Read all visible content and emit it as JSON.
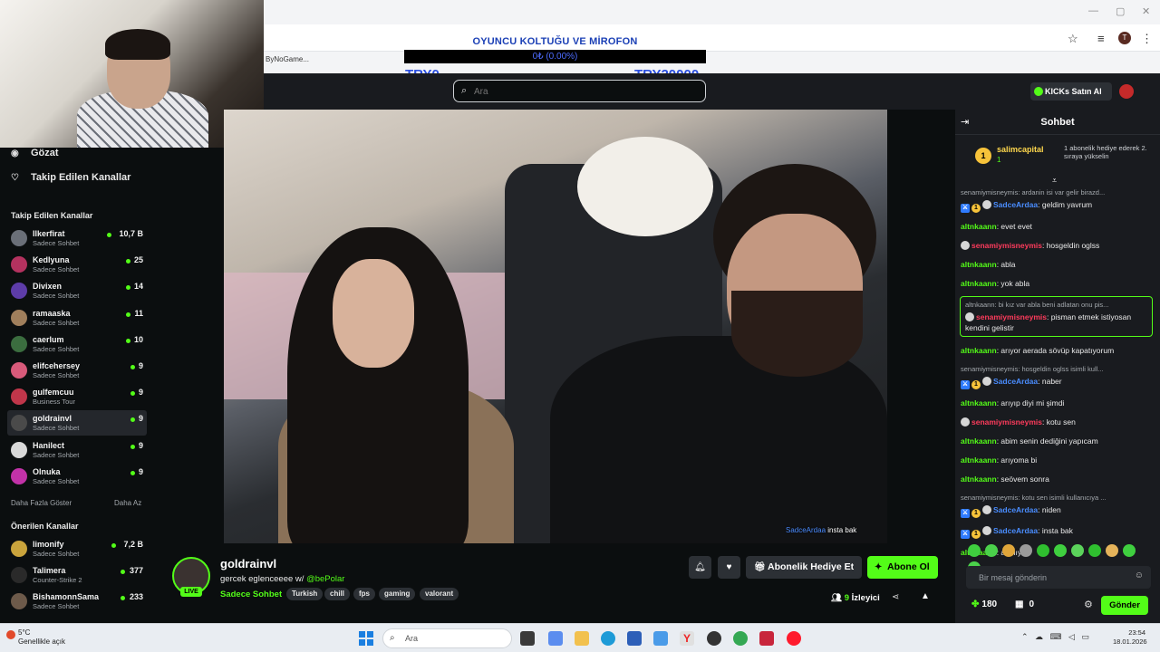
{
  "browser": {
    "bookmark": "ByNoGame...",
    "avatar_letter": "T",
    "window_controls": [
      "—",
      "▢",
      "✕"
    ]
  },
  "overlay": {
    "goal_title": "OYUNCU KOLTUĞU VE MİROFON",
    "goal_progress": "0₺ (0.00%)",
    "goal_progress_fraction": 0.0,
    "goal_min": "TRY0",
    "goal_max": "TRY20000"
  },
  "header": {
    "search_placeholder": "Ara",
    "kicks_button": "KICKs Satın Al"
  },
  "sidebar": {
    "nav": [
      {
        "label": "Gözat",
        "icon": "compass-icon"
      },
      {
        "label": "Takip Edilen Kanallar",
        "icon": "heart-icon"
      }
    ],
    "followed_title": "Takip Edilen Kanallar",
    "followed": [
      {
        "name": "Ilkerfirat",
        "category": "Sadece Sohbet",
        "viewers": "10,7 B",
        "color": "#6a6f78"
      },
      {
        "name": "Kedlyuna",
        "category": "Sadece Sohbet",
        "viewers": "25",
        "color": "#b4325f"
      },
      {
        "name": "Divixen",
        "category": "Sadece Sohbet",
        "viewers": "14",
        "color": "#5d3ca8"
      },
      {
        "name": "ramaaska",
        "category": "Sadece Sohbet",
        "viewers": "11",
        "color": "#a07f5c"
      },
      {
        "name": "caerlum",
        "category": "Sadece Sohbet",
        "viewers": "10",
        "color": "#3b6d3f"
      },
      {
        "name": "elifcehersey",
        "category": "Sadece Sohbet",
        "viewers": "9",
        "color": "#d85a7a"
      },
      {
        "name": "gulfemcuu",
        "category": "Business Tour",
        "viewers": "9",
        "color": "#c0364a"
      },
      {
        "name": "goldrainvl",
        "category": "Sadece Sohbet",
        "viewers": "9",
        "color": "#4a4a4a"
      },
      {
        "name": "Hanilect",
        "category": "Sadece Sohbet",
        "viewers": "9",
        "color": "#d9d9d9"
      },
      {
        "name": "Olnuka",
        "category": "Sadece Sohbet",
        "viewers": "9",
        "color": "#c232a8"
      }
    ],
    "show_more": "Daha Fazla Göster",
    "show_less": "Daha Az",
    "recommended_title": "Önerilen Kanallar",
    "recommended": [
      {
        "name": "limonify",
        "category": "Sadece Sohbet",
        "viewers": "7,2 B",
        "color": "#caa43c"
      },
      {
        "name": "Talimera",
        "category": "Counter-Strike 2",
        "viewers": "377",
        "color": "#2a2a2a"
      },
      {
        "name": "BishamonnSama",
        "category": "Sadece Sohbet",
        "viewers": "233",
        "color": "#6d5a4a"
      }
    ]
  },
  "video": {
    "caption_user": "SadceArdaa",
    "caption_text": "insta bak"
  },
  "stream": {
    "streamer": "goldrainvl",
    "live": "LIVE",
    "title_prefix": "gercek eglenceeee w/ ",
    "title_mention": "@bePolar",
    "category": "Sadece Sohbet",
    "tags": [
      "Turkish",
      "chill",
      "fps",
      "gaming",
      "valorant"
    ],
    "gift_button": "Abonelik Hediye Et",
    "subscribe_button": "Abone Ol",
    "viewers": "9",
    "viewers_label": "İzleyici"
  },
  "chat": {
    "title": "Sohbet",
    "pinned": {
      "rank": "1",
      "user": "salimcapital",
      "sub_count": "1",
      "message": "1 abonelik hediye ederek 2. sıraya yükselin"
    },
    "messages": [
      {
        "reply": "senamiymisneymis: ardanin isi var gelir birazd...",
        "badges": [
          "mod",
          "sub1",
          "emo"
        ],
        "user": "SadceArdaa",
        "color": "blue",
        "text": "geldim yavrum"
      },
      {
        "user": "altnkaann",
        "color": "green",
        "text": "evet evet"
      },
      {
        "badges": [
          "emo"
        ],
        "user": "senamiymisneymis",
        "color": "red",
        "text": "hosgeldin oglss"
      },
      {
        "user": "altnkaann",
        "color": "green",
        "text": "abla"
      },
      {
        "user": "altnkaann",
        "color": "green",
        "text": "yok abla"
      },
      {
        "highlight": true,
        "reply": "altnkaann: bi kız var abla beni adlatan onu pis...",
        "badges": [
          "emo"
        ],
        "user": "senamiymisneymis",
        "color": "red",
        "text": "pisman etmek istiyosan kendini gelistir"
      },
      {
        "user": "altnkaann",
        "color": "green",
        "text": "arıyor aerada sövüp kapatıyorum"
      },
      {
        "reply": "senamiymisneymis: hosgeldin oglss isimli kull...",
        "badges": [
          "mod",
          "sub1",
          "emo"
        ],
        "user": "SadceArdaa",
        "color": "blue",
        "text": "naber"
      },
      {
        "user": "altnkaann",
        "color": "green",
        "text": "arıyıp diyi mi şimdi"
      },
      {
        "badges": [
          "emo"
        ],
        "user": "senamiymisneymis",
        "color": "red",
        "text": "kotu sen"
      },
      {
        "user": "altnkaann",
        "color": "green",
        "text": "abim senin dediğini yapıcam"
      },
      {
        "user": "altnkaann",
        "color": "green",
        "text": "arıyoma bi"
      },
      {
        "user": "altnkaann",
        "color": "green",
        "text": "seövem sonra"
      },
      {
        "reply": "senamiymisneymis: kotu sen isimli kullanıcıya ...",
        "badges": [
          "mod",
          "sub1",
          "emo"
        ],
        "user": "SadceArdaa",
        "color": "blue",
        "text": "niden"
      },
      {
        "badges": [
          "mod",
          "sub1",
          "emo"
        ],
        "user": "SadceArdaa",
        "color": "blue",
        "text": "insta bak"
      },
      {
        "user": "altnkaann",
        "color": "green",
        "text": "açmıyo"
      }
    ],
    "input_placeholder": "Bir mesaj gönderin",
    "kicks_count": "180",
    "gift_count": "0",
    "send_button": "Gönder"
  },
  "taskbar": {
    "temperature": "5°C",
    "weather": "Genellikle açık",
    "search": "Ara",
    "time": "23:54",
    "date": "18.01.2026"
  },
  "colors": {
    "accent": "#53fc18",
    "bg": "#0b0e0f",
    "panel": "#191b1f"
  }
}
